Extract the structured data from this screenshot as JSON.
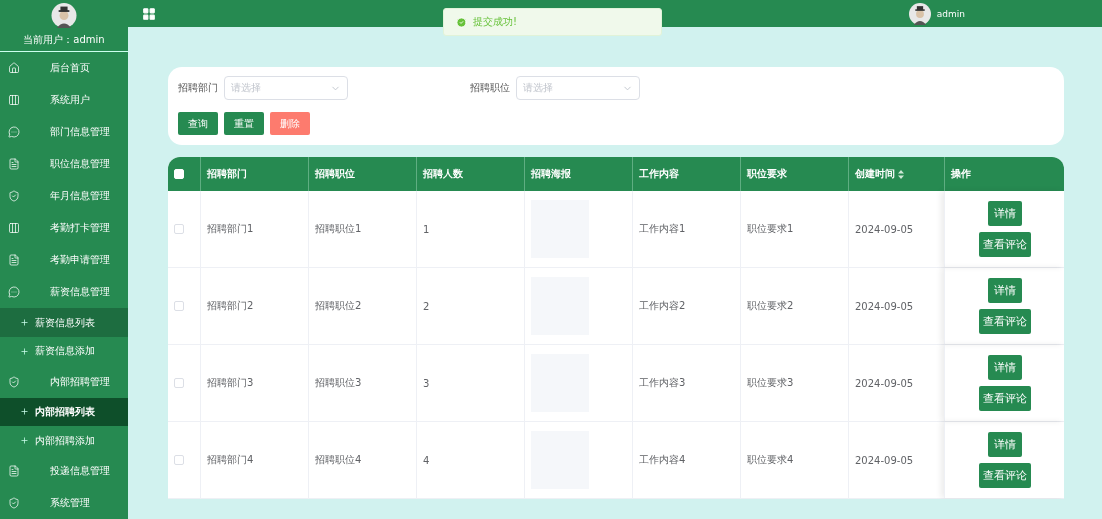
{
  "sidebar": {
    "user_label": "当前用户：",
    "user_name": "admin",
    "items": [
      {
        "label": "后台首页",
        "kind": "menu",
        "selected": false,
        "highlighted": false
      },
      {
        "label": "系统用户",
        "kind": "menu",
        "selected": false,
        "highlighted": false
      },
      {
        "label": "部门信息管理",
        "kind": "menu",
        "selected": false,
        "highlighted": false
      },
      {
        "label": "职位信息管理",
        "kind": "menu",
        "selected": false,
        "highlighted": false
      },
      {
        "label": "年月信息管理",
        "kind": "menu",
        "selected": false,
        "highlighted": false
      },
      {
        "label": "考勤打卡管理",
        "kind": "menu",
        "selected": false,
        "highlighted": false
      },
      {
        "label": "考勤申请管理",
        "kind": "menu",
        "selected": false,
        "highlighted": false
      },
      {
        "label": "薪资信息管理",
        "kind": "menu",
        "selected": false,
        "highlighted": false
      },
      {
        "label": "薪资信息列表",
        "kind": "submenu",
        "selected": false,
        "highlighted": true
      },
      {
        "label": "薪资信息添加",
        "kind": "submenu",
        "selected": false,
        "highlighted": false
      },
      {
        "label": "内部招聘管理",
        "kind": "menu",
        "selected": false,
        "highlighted": false
      },
      {
        "label": "内部招聘列表",
        "kind": "submenu",
        "selected": true,
        "highlighted": false
      },
      {
        "label": "内部招聘添加",
        "kind": "submenu",
        "selected": false,
        "highlighted": false
      },
      {
        "label": "投递信息管理",
        "kind": "menu",
        "selected": false,
        "highlighted": false
      },
      {
        "label": "系统管理",
        "kind": "menu",
        "selected": false,
        "highlighted": false
      }
    ]
  },
  "header": {
    "user_name": "admin"
  },
  "toast": {
    "message": "提交成功!"
  },
  "filters": [
    {
      "label": "招聘部门",
      "placeholder": "请选择"
    },
    {
      "label": "招聘职位",
      "placeholder": "请选择"
    }
  ],
  "buttons": [
    {
      "label": "查询",
      "kind": "primary"
    },
    {
      "label": "重置",
      "kind": "primary"
    },
    {
      "label": "删除",
      "kind": "danger"
    }
  ],
  "table": {
    "columns": [
      "招聘部门",
      "招聘职位",
      "招聘人数",
      "招聘海报",
      "工作内容",
      "职位要求",
      "创建时间",
      "操作"
    ],
    "rows": [
      {
        "checked": false,
        "cells": [
          "招聘部门1",
          "招聘职位1",
          "1",
          "",
          "工作内容1",
          "职位要求1",
          "2024-09-05"
        ],
        "actions": [
          "详情",
          "查看评论"
        ]
      },
      {
        "checked": false,
        "cells": [
          "招聘部门2",
          "招聘职位2",
          "2",
          "",
          "工作内容2",
          "职位要求2",
          "2024-09-05"
        ],
        "actions": [
          "详情",
          "查看评论"
        ]
      },
      {
        "checked": false,
        "cells": [
          "招聘部门3",
          "招聘职位3",
          "3",
          "",
          "工作内容3",
          "职位要求3",
          "2024-09-05"
        ],
        "actions": [
          "详情",
          "查看评论"
        ]
      },
      {
        "checked": false,
        "cells": [
          "招聘部门4",
          "招聘职位4",
          "4",
          "",
          "工作内容4",
          "职位要求4",
          "2024-09-05"
        ],
        "actions": [
          "详情",
          "查看评论"
        ]
      }
    ],
    "select_all_checked": false
  }
}
